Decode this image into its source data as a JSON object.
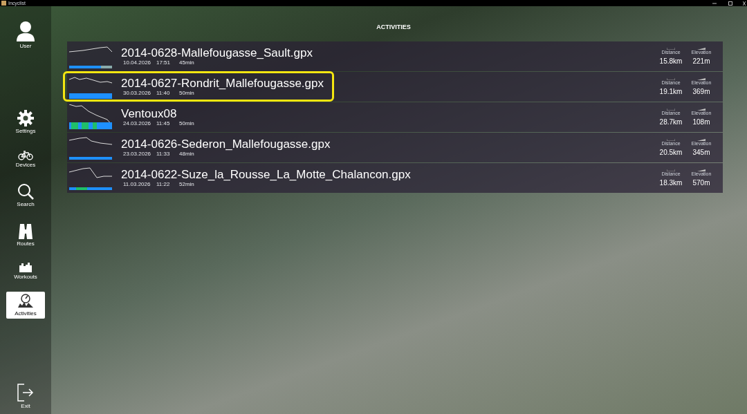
{
  "window": {
    "title": "Incyclist"
  },
  "sidebar": {
    "items": [
      {
        "kind": "user",
        "label": "User",
        "selected": false
      },
      {
        "kind": "settings",
        "label": "Settings",
        "selected": false
      },
      {
        "kind": "devices",
        "label": "Devices",
        "selected": false
      },
      {
        "kind": "search",
        "label": "Search",
        "selected": false
      },
      {
        "kind": "routes",
        "label": "Routes",
        "selected": false
      },
      {
        "kind": "workouts",
        "label": "Workouts",
        "selected": false
      },
      {
        "kind": "activities",
        "label": "Activities",
        "selected": true
      },
      {
        "kind": "exit",
        "label": "Exit",
        "selected": false
      }
    ]
  },
  "page_title": "ACTIVITIES",
  "activities": [
    {
      "name": "2014-0628-Mallefougasse_Sault.gpx",
      "date": "10.04.2026",
      "time": "17:51",
      "duration": "45min",
      "distance_label": "Distance",
      "distance": "15.8km",
      "elevation_label": "Elevation",
      "elevation": "221m",
      "highlighted": false
    },
    {
      "name": "2014-0627-Rondrit_Mallefougasse.gpx",
      "date": "30.03.2026",
      "time": "11:40",
      "duration": "50min",
      "distance_label": "Distance",
      "distance": "19.1km",
      "elevation_label": "Elevation",
      "elevation": "369m",
      "highlighted": true
    },
    {
      "name": "Ventoux08",
      "date": "24.03.2026",
      "time": "11:45",
      "duration": "50min",
      "distance_label": "Distance",
      "distance": "28.7km",
      "elevation_label": "Elevation",
      "elevation": "108m",
      "highlighted": false
    },
    {
      "name": "2014-0626-Sederon_Mallefougasse.gpx",
      "date": "23.03.2026",
      "time": "11:33",
      "duration": "48min",
      "distance_label": "Distance",
      "distance": "20.5km",
      "elevation_label": "Elevation",
      "elevation": "345m",
      "highlighted": false
    },
    {
      "name": "2014-0622-Suze_la_Rousse_La_Motte_Chalancon.gpx",
      "date": "11.03.2026",
      "time": "11:22",
      "duration": "52min",
      "distance_label": "Distance",
      "distance": "18.3km",
      "elevation_label": "Elevation",
      "elevation": "570m",
      "highlighted": false
    }
  ]
}
